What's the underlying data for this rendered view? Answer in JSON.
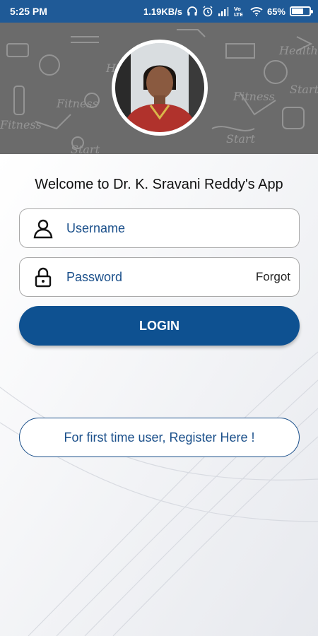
{
  "status_bar": {
    "time": "5:25 PM",
    "network_speed": "1.19KB/s",
    "battery_percent": "65%",
    "battery_level": 0.65,
    "icons": [
      "headphones-icon",
      "alarm-icon",
      "signal-icon",
      "volte-icon",
      "wifi-icon",
      "battery-icon"
    ]
  },
  "hero": {
    "avatar_alt": "profile photo",
    "pattern": "fitness-doodle-pattern"
  },
  "welcome_text": "Welcome to Dr. K. Sravani Reddy's App",
  "username": {
    "placeholder": "Username",
    "value": "",
    "icon": "user-icon"
  },
  "password": {
    "placeholder": "Password",
    "value": "",
    "icon": "lock-icon",
    "forgot_label": "Forgot"
  },
  "login_label": "LOGIN",
  "register_label": "For first time user, Register Here !",
  "colors": {
    "status_bar": "#1f5a97",
    "primary": "#0e5191",
    "text_accent": "#1a4f8a"
  }
}
